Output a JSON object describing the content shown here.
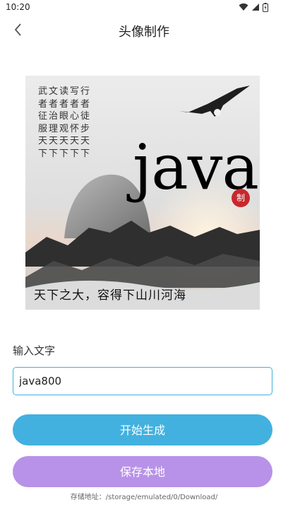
{
  "status_bar": {
    "time": "10:20"
  },
  "nav": {
    "title": "头像制作"
  },
  "preview": {
    "poem": "武文读写行\n者者者者者\n征治眼心徒\n服理观怀步\n天天天天天\n下下下下下",
    "big_text": "java",
    "seal": "制",
    "slogan": "天下之大，容得下山川河海"
  },
  "form": {
    "label": "输入文字",
    "input_value": "java800"
  },
  "buttons": {
    "generate": "开始生成",
    "save": "保存本地"
  },
  "footer": {
    "save_path": "存储地址：/storage/emulated/0/Download/"
  },
  "colors": {
    "accent": "#42b1df",
    "save_button": "#b892e8",
    "input_border": "#3eb1e0"
  }
}
